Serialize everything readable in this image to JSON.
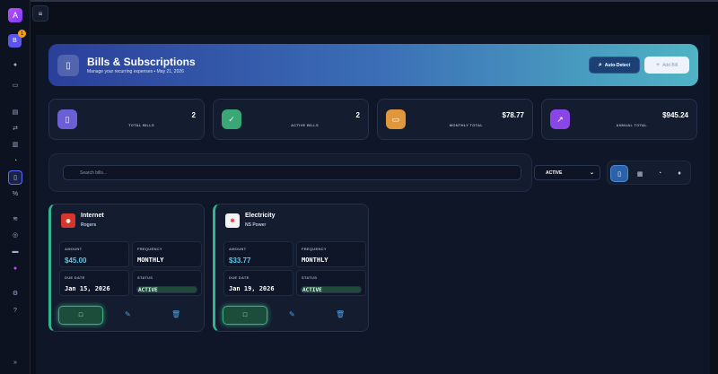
{
  "rail": {
    "logo": "A",
    "avatar": "B",
    "notif_count": "1"
  },
  "header": {
    "title": "Bills & Subscriptions",
    "subtitle": "Manage your recurring expenses • May 21, 2026",
    "auto_detect_label": "Auto-Detect",
    "add_bill_label": "Add Bill"
  },
  "stats": [
    {
      "label": "TOTAL BILLS",
      "value": "2",
      "color": "#6b5fd6",
      "icon": "document-icon"
    },
    {
      "label": "ACTIVE BILLS",
      "value": "2",
      "color": "#3aa776",
      "icon": "check-icon"
    },
    {
      "label": "MONTHLY TOTAL",
      "value": "$78.77",
      "color": "#e0963a",
      "icon": "money-icon"
    },
    {
      "label": "ANNUAL TOTAL",
      "value": "$945.24",
      "color": "#8a45e6",
      "icon": "chart-icon"
    }
  ],
  "filters": {
    "search_placeholder": "Search bills...",
    "status_selected": "ACTIVE"
  },
  "bills": [
    {
      "name": "Internet",
      "provider": "Rogers",
      "amount_label": "AMOUNT",
      "amount": "$45.00",
      "frequency_label": "FREQUENCY",
      "frequency": "MONTHLY",
      "due_label": "DUE DATE",
      "due": "Jan 15, 2026",
      "status_label": "STATUS",
      "status": "ACTIVE",
      "logo_color": "#d8352c"
    },
    {
      "name": "Electricity",
      "provider": "NS Power",
      "amount_label": "AMOUNT",
      "amount": "$33.77",
      "frequency_label": "FREQUENCY",
      "frequency": "MONTHLY",
      "due_label": "DUE DATE",
      "due": "Jan 19, 2026",
      "status_label": "STATUS",
      "status": "ACTIVE",
      "logo_color": "#e23b3b"
    }
  ]
}
